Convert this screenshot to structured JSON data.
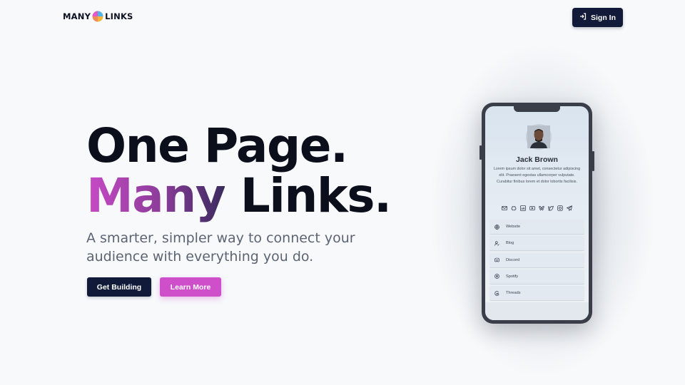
{
  "header": {
    "logo_left": "MANY",
    "logo_right": "LINKS",
    "signin_label": "Sign In"
  },
  "hero": {
    "title_line1": "One Page.",
    "title_many": "Many",
    "title_links": " Links.",
    "subtitle": "A smarter, simpler way to connect your audience with everything you do.",
    "primary_cta": "Get Building",
    "secondary_cta": "Learn More"
  },
  "phone": {
    "profile_name": "Jack Brown",
    "bio": "Lorem ipsum dolor sit amet, consectetur adipiscing elit. Praesent egestas ullamcorper vulputate. Curabitur finibus lorem et dolor lobortis facilisis.",
    "social_icons": [
      "mail-icon",
      "github-icon",
      "linkedin-icon",
      "youtube-icon",
      "bluesky-icon",
      "twitter-icon",
      "instagram-icon",
      "telegram-icon"
    ],
    "links": [
      {
        "label": "Website",
        "icon": "globe-icon"
      },
      {
        "label": "Blog",
        "icon": "user-edit-icon"
      },
      {
        "label": "Discord",
        "icon": "discord-icon"
      },
      {
        "label": "Spotify",
        "icon": "spotify-icon"
      },
      {
        "label": "Threads",
        "icon": "threads-icon"
      }
    ]
  },
  "colors": {
    "navy": "#111a38",
    "magenta": "#cf4fcb",
    "background": "#f7f9fb"
  }
}
